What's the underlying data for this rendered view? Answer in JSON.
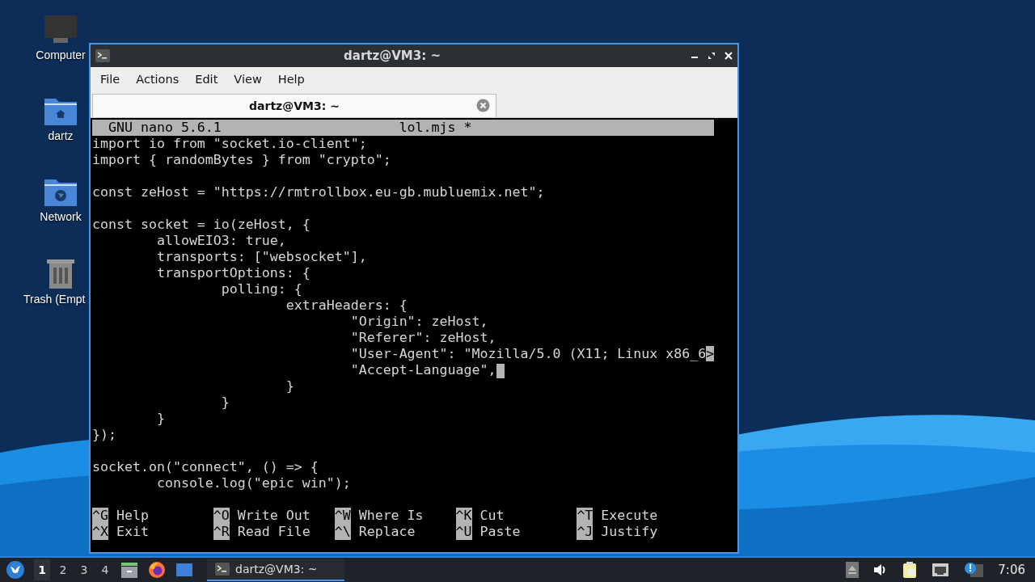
{
  "desktop_icons": [
    {
      "kind": "computer",
      "label": "Computer"
    },
    {
      "kind": "home",
      "label": "dartz"
    },
    {
      "kind": "network",
      "label": "Network"
    },
    {
      "kind": "trash",
      "label": "Trash (Empt"
    }
  ],
  "window": {
    "title": "dartz@VM3: ~"
  },
  "menu": [
    "File",
    "Actions",
    "Edit",
    "View",
    "Help"
  ],
  "tabs": [
    {
      "label": "dartz@VM3: ~",
      "selected": true
    }
  ],
  "nano": {
    "version": "GNU nano 5.6.1",
    "filename": "lol.mjs *",
    "lines": [
      {
        "kind": "code",
        "text": "import io from \"socket.io-client\";"
      },
      {
        "kind": "code",
        "text": "import { randomBytes } from \"crypto\";"
      },
      {
        "kind": "blank"
      },
      {
        "kind": "code",
        "text": "const zeHost = \"https://rmtrollbox.eu-gb.mubluemix.net\";"
      },
      {
        "kind": "blank"
      },
      {
        "kind": "code",
        "text": "const socket = io(zeHost, {"
      },
      {
        "kind": "code",
        "text": "        allowEIO3: true,"
      },
      {
        "kind": "code",
        "text": "        transports: [\"websocket\"],"
      },
      {
        "kind": "code",
        "text": "        transportOptions: {"
      },
      {
        "kind": "code",
        "text": "                polling: {"
      },
      {
        "kind": "code",
        "text": "                        extraHeaders: {"
      },
      {
        "kind": "code",
        "text": "                                \"Origin\": zeHost,"
      },
      {
        "kind": "code",
        "text": "                                \"Referer\": zeHost,"
      },
      {
        "kind": "code",
        "text": "                                \"User-Agent\": \"Mozilla/5.0 (X11; Linux x86_6",
        "overflow_marker": ">"
      },
      {
        "kind": "code",
        "text": "                                \"Accept-Language\",",
        "cursor": true
      },
      {
        "kind": "code",
        "text": "                        }"
      },
      {
        "kind": "code",
        "text": "                }"
      },
      {
        "kind": "code",
        "text": "        }"
      },
      {
        "kind": "code",
        "text": "});"
      },
      {
        "kind": "blank"
      },
      {
        "kind": "code",
        "text": "socket.on(\"connect\", () => {"
      },
      {
        "kind": "code",
        "text": "        console.log(\"epic win\");"
      }
    ],
    "shortcuts": [
      {
        "key": "^G",
        "label": "Help"
      },
      {
        "key": "^O",
        "label": "Write Out"
      },
      {
        "key": "^W",
        "label": "Where Is"
      },
      {
        "key": "^K",
        "label": "Cut"
      },
      {
        "key": "^T",
        "label": "Execute"
      },
      {
        "key": "^X",
        "label": "Exit"
      },
      {
        "key": "^R",
        "label": "Read File"
      },
      {
        "key": "^\\",
        "label": "Replace"
      },
      {
        "key": "^U",
        "label": "Paste"
      },
      {
        "key": "^J",
        "label": "Justify"
      }
    ]
  },
  "taskbar": {
    "workspaces": [
      {
        "label": "1",
        "selected": true
      },
      {
        "label": "2",
        "selected": false
      },
      {
        "label": "3",
        "selected": false
      },
      {
        "label": "4",
        "selected": false
      }
    ],
    "tasks": [
      {
        "label": "dartz@VM3: ~",
        "selected": true
      }
    ],
    "clock": "7:06"
  }
}
